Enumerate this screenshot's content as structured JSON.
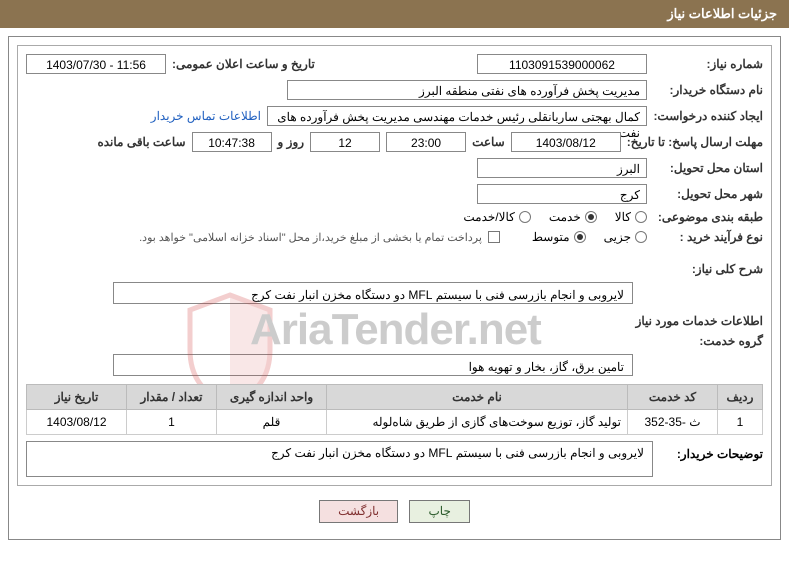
{
  "header": {
    "title": "جزئیات اطلاعات نیاز"
  },
  "fields": {
    "need_number_label": "شماره نیاز:",
    "need_number": "1103091539000062",
    "announce_datetime_label": "تاریخ و ساعت اعلان عمومی:",
    "announce_datetime": "1403/07/30 - 11:56",
    "buyer_org_label": "نام دستگاه خریدار:",
    "buyer_org": "مدیریت پخش فرآورده های نفتی منطقه البرز",
    "requester_label": "ایجاد کننده درخواست:",
    "requester": "کمال بهجتی ساربانقلی رئیس خدمات مهندسی  مدیریت پخش فرآورده های نفت",
    "buyer_contact_link": "اطلاعات تماس خریدار",
    "deadline_label": "مهلت ارسال پاسخ: تا تاریخ:",
    "deadline_date": "1403/08/12",
    "time_label": "ساعت",
    "deadline_time": "23:00",
    "days_count": "12",
    "days_and_label": "روز و",
    "remaining_time": "10:47:38",
    "remaining_label": "ساعت باقی مانده",
    "province_label": "استان محل تحویل:",
    "province": "البرز",
    "city_label": "شهر محل تحویل:",
    "city": "کرج",
    "category_label": "طبقه بندی موضوعی:",
    "cat_goods": "کالا",
    "cat_service": "خدمت",
    "cat_both": "کالا/خدمت",
    "purchase_type_label": "نوع فرآیند خرید :",
    "pt_minor": "جزیی",
    "pt_medium": "متوسط",
    "payment_note": "پرداخت تمام یا بخشی از مبلغ خرید،از محل \"اسناد خزانه اسلامی\" خواهد بود."
  },
  "general_desc": {
    "label": "شرح کلی نیاز:",
    "text": "لایروبی و انجام بازرسی فنی با سیستم MFL دو دستگاه مخزن انبار نفت کرج"
  },
  "services_section": {
    "title": "اطلاعات خدمات مورد نیاز",
    "group_label": "گروه خدمت:",
    "group_value": "تامین برق، گاز، بخار و تهویه هوا"
  },
  "table": {
    "headers": {
      "row": "ردیف",
      "code": "کد خدمت",
      "name": "نام خدمت",
      "unit": "واحد اندازه گیری",
      "qty": "تعداد / مقدار",
      "date": "تاریخ نیاز"
    },
    "rows": [
      {
        "row": "1",
        "code": "ث -35-352",
        "name": "تولید گاز، توزیع سوخت‌های گازی از طریق شاه‌لوله",
        "unit": "قلم",
        "qty": "1",
        "date": "1403/08/12"
      }
    ]
  },
  "buyer_remarks": {
    "label": "توضیحات خریدار:",
    "text": "لایروبی و انجام بازرسی فنی با سیستم MFL دو دستگاه مخزن انبار نفت کرج"
  },
  "buttons": {
    "print": "چاپ",
    "back": "بازگشت"
  },
  "watermark": {
    "text": "AriaTender.net"
  }
}
